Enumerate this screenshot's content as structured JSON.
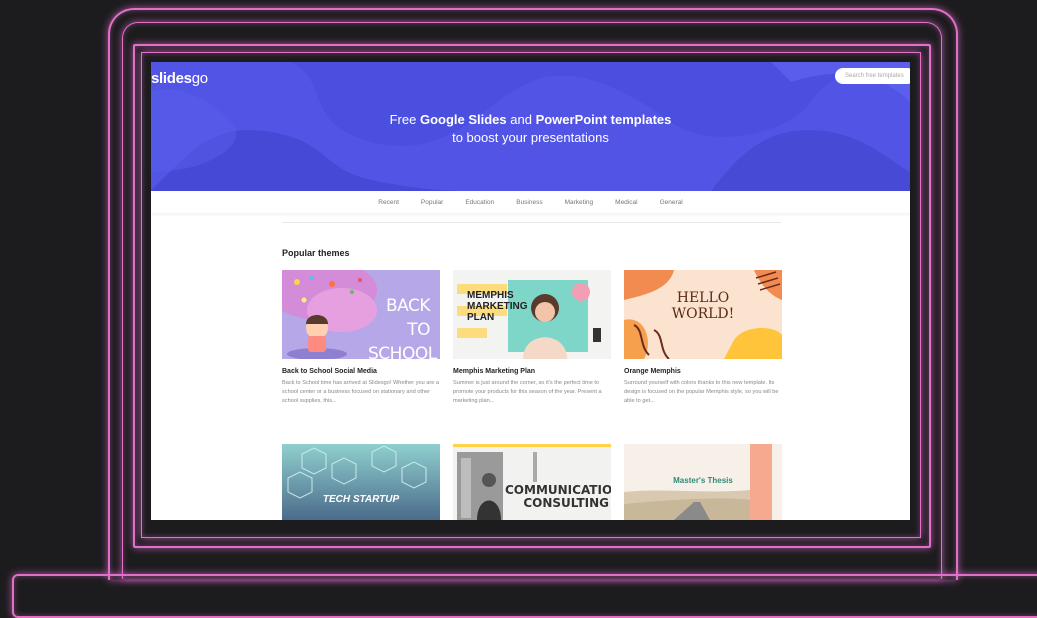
{
  "site": {
    "logo_main": "slides",
    "logo_suffix": "go",
    "search_placeholder": "Search free templates"
  },
  "hero": {
    "line1_part1": "Free ",
    "line1_bold1": "Google Slides",
    "line1_part2": " and ",
    "line1_bold2": "PowerPoint templates",
    "line2": "to boost your presentations"
  },
  "nav": {
    "items": [
      "Recent",
      "Popular",
      "Education",
      "Business",
      "Marketing",
      "Medical",
      "General"
    ]
  },
  "section": {
    "title": "Popular themes"
  },
  "cards": [
    {
      "title": "Back to School Social Media",
      "description": "Back to School time has arrived at Slidesgo! Whether you are a school center or a business focused on stationary and other school supplies, this...",
      "thumb_text_1": "BACK TO",
      "thumb_text_2": "SCHOOL"
    },
    {
      "title": "Memphis Marketing Plan",
      "description": "Summer is just around the corner, so it’s the perfect time to promote your products for this season of the year. Present a marketing plan...",
      "thumb_text_1": "MEMPHIS",
      "thumb_text_2": "MARKETING",
      "thumb_text_3": "PLAN"
    },
    {
      "title": "Orange Memphis",
      "description": "Surround yourself with colors thanks to this new template. Its design is focused on the popular Memphis style, so you will be able to get...",
      "thumb_text_1": "HELLO",
      "thumb_text_2": "WORLD!"
    },
    {
      "thumb_text_1": "TECH STARTUP"
    },
    {
      "thumb_text_1": "COMMUNICATION",
      "thumb_text_2": "CONSULTING"
    },
    {
      "thumb_text_1": "Master's Thesis"
    }
  ],
  "colors": {
    "hero": "#4b4fe0",
    "neon": "#e070c8",
    "background": "#1c1c1e"
  }
}
